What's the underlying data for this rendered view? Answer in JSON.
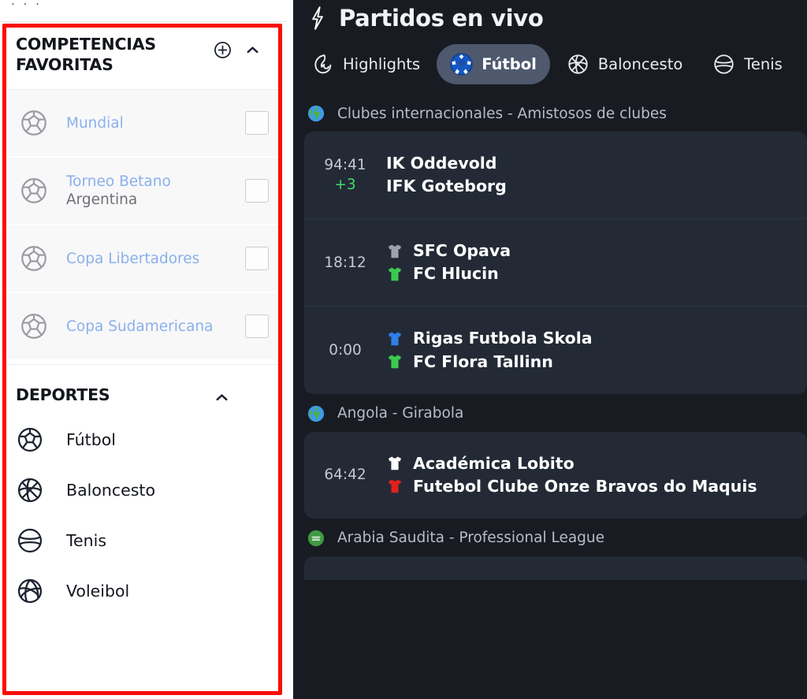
{
  "sidebar": {
    "favorites": {
      "title": "COMPETENCIAS FAVORITAS",
      "add_icon": "circle-plus-icon",
      "collapse_icon": "chevron-up-icon",
      "items": [
        {
          "name": "Mundial",
          "subtitle": "",
          "icon": "soccer-ball-icon",
          "checked": false
        },
        {
          "name": "Torneo Betano",
          "subtitle": "Argentina",
          "icon": "soccer-ball-icon",
          "checked": false
        },
        {
          "name": "Copa Libertadores",
          "subtitle": "",
          "icon": "soccer-ball-icon",
          "checked": false
        },
        {
          "name": "Copa Sudamericana",
          "subtitle": "",
          "icon": "soccer-ball-icon",
          "checked": false
        }
      ]
    },
    "sports": {
      "title": "DEPORTES",
      "collapse_icon": "chevron-up-icon",
      "items": [
        {
          "label": "Fútbol",
          "icon": "soccer-ball-icon"
        },
        {
          "label": "Baloncesto",
          "icon": "basketball-icon"
        },
        {
          "label": "Tenis",
          "icon": "tennis-ball-icon"
        },
        {
          "label": "Voleibol",
          "icon": "volleyball-icon"
        }
      ]
    }
  },
  "live": {
    "title": "Partidos en vivo",
    "title_icon": "lightning-bolt-icon",
    "tabs": [
      {
        "label": "Highlights",
        "icon": "flame-icon",
        "active": false
      },
      {
        "label": "Fútbol",
        "icon": "soccer-ball-icon",
        "active": true
      },
      {
        "label": "Baloncesto",
        "icon": "basketball-icon",
        "active": false
      },
      {
        "label": "Tenis",
        "icon": "tennis-ball-icon",
        "active": false
      }
    ],
    "leagues": [
      {
        "name": "Clubes internacionales - Amistosos de clubes",
        "flag_icon": "globe-icon",
        "matches": [
          {
            "clock": "94:41",
            "clock_extra": "+3",
            "home": "IK Oddevold",
            "away": "IFK Goteborg",
            "home_shirt_color": "",
            "away_shirt_color": ""
          },
          {
            "clock": "18:12",
            "clock_extra": "",
            "home": "SFC Opava",
            "away": "FC Hlucin",
            "home_shirt_color": "#9ca3ad",
            "away_shirt_color": "#3bc94f"
          },
          {
            "clock": "0:00",
            "clock_extra": "",
            "home": "Rigas Futbola Skola",
            "away": "FC Flora Tallinn",
            "home_shirt_color": "#2f7fe8",
            "away_shirt_color": "#3bc94f"
          }
        ]
      },
      {
        "name": "Angola - Girabola",
        "flag_icon": "globe-icon",
        "matches": [
          {
            "clock": "64:42",
            "clock_extra": "",
            "home": "Académica Lobito",
            "away": "Futebol Clube Onze Bravos do Maquis",
            "home_shirt_color": "#ffffff",
            "away_shirt_color": "#e0211d"
          }
        ]
      },
      {
        "name": "Arabia Saudita - Professional League",
        "flag_icon": "saudi-flag-icon",
        "matches": []
      }
    ]
  },
  "colors": {
    "annotation_box": "#fa0c06",
    "panel_bg": "#181c22",
    "card_bg": "#232a36",
    "active_tab_bg": "#4e596e",
    "link_blue": "#8ab0ec",
    "live_green": "#3ddc6a"
  }
}
